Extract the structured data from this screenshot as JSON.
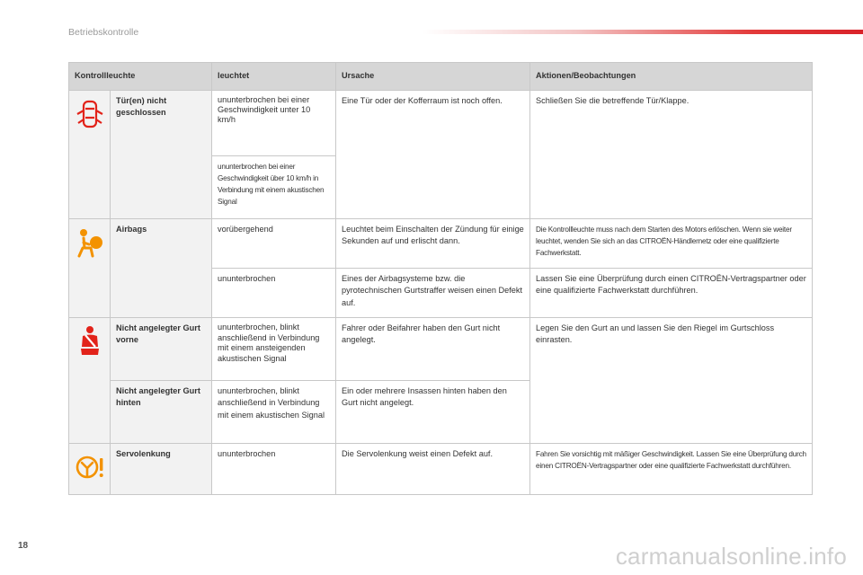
{
  "header": {
    "section_title": "Betriebskontrolle",
    "page_number": "18"
  },
  "table": {
    "columns": [
      "Kontrollleuchte",
      "leuchtet",
      "Ursache",
      "Aktionen/Beobachtungen"
    ],
    "rows": {
      "door": {
        "name": "Tür(en) nicht geschlossen",
        "icon": "door-open-icon",
        "when_1": "ununterbrochen bei einer Geschwindigkeit unter 10 km/h",
        "when_2": "ununterbrochen bei einer Geschwindigkeit über 10 km/h in Verbindung mit einem akustischen Signal",
        "cause": "Eine Tür oder der Kofferraum ist noch offen.",
        "action": "Schließen Sie die betreffende Tür/Klappe."
      },
      "airbags": {
        "name": "Airbags",
        "icon": "airbag-icon",
        "when_1": "vorübergehend",
        "cause_1": "Leuchtet beim Einschalten der Zündung für einige Sekunden auf und erlischt dann.",
        "action_1": "Die Kontrollleuchte muss nach dem Starten des Motors erlöschen. Wenn sie weiter leuchtet, wenden Sie sich an das CITROËN-Händlernetz oder eine qualifizierte Fachwerkstatt.",
        "when_2": "ununterbrochen",
        "cause_2": "Eines der Airbagsysteme bzw. die pyrotechnischen Gurtstraffer weisen einen Defekt auf.",
        "action_2": "Lassen Sie eine Überprüfung durch einen CITROËN-Vertragspartner oder eine qualifizierte Fachwerkstatt durchführen."
      },
      "belt": {
        "icon": "seatbelt-icon",
        "name_1": "Nicht angelegter Gurt vorne",
        "when_1": "ununterbrochen, blinkt anschließend in Verbindung mit einem ansteigenden akustischen Signal",
        "cause_1": "Fahrer oder Beifahrer haben den Gurt nicht angelegt.",
        "action": "Legen Sie den Gurt an und lassen Sie den Riegel im Gurtschloss einrasten.",
        "name_2": "Nicht angelegter Gurt hinten",
        "when_2": "ununterbrochen, blinkt anschließend in Verbindung mit einem akustischen Signal",
        "cause_2": "Ein oder mehrere Insassen hinten haben den Gurt nicht angelegt."
      },
      "steering": {
        "name": "Servolenkung",
        "icon": "power-steering-icon",
        "when": "ununterbrochen",
        "cause": "Die Servolenkung weist einen Defekt auf.",
        "action": "Fahren Sie vorsichtig mit mäßiger Geschwindigkeit. Lassen Sie eine Überprüfung durch einen CITROËN-Vertragspartner oder eine qualifizierte Fachwerkstatt durchführen."
      }
    }
  },
  "watermark": "carmanualsonline.info",
  "colors": {
    "warning_red": "#e2231a",
    "warning_orange": "#f39200",
    "header_bg": "#d6d6d6",
    "icon_cell_bg": "#f2f2f2"
  }
}
